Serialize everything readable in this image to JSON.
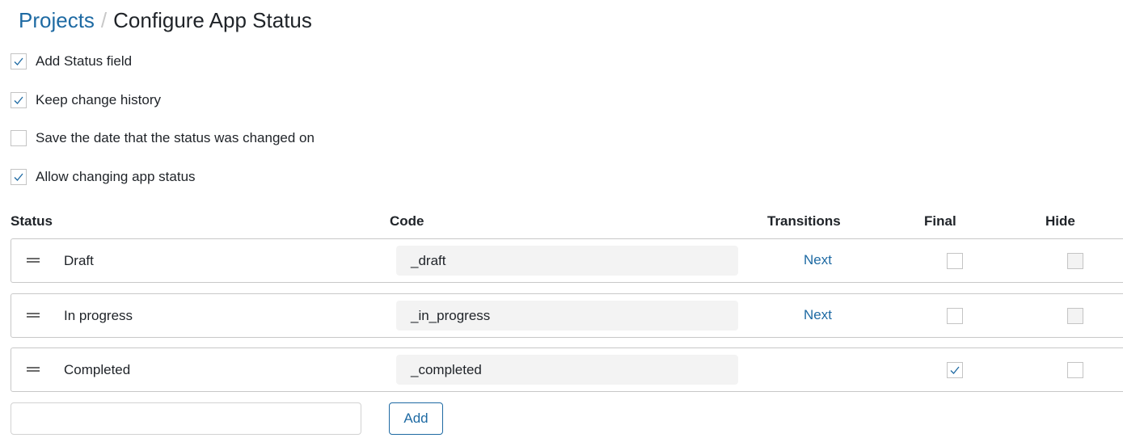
{
  "breadcrumb": {
    "parent": "Projects",
    "separator": "/",
    "title": "Configure App Status"
  },
  "options": [
    {
      "label": "Add Status field",
      "checked": true
    },
    {
      "label": "Keep change history",
      "checked": true
    },
    {
      "label": "Save the date that the status was changed on",
      "checked": false
    },
    {
      "label": "Allow changing app status",
      "checked": true
    }
  ],
  "table": {
    "headers": {
      "status": "Status",
      "code": "Code",
      "transitions": "Transitions",
      "final": "Final",
      "hide": "Hide"
    },
    "rows": [
      {
        "status": "Draft",
        "code": "_draft",
        "transition": "Next",
        "final": false,
        "hide": false,
        "hide_disabled": true
      },
      {
        "status": "In progress",
        "code": "_in_progress",
        "transition": "Next",
        "final": false,
        "hide": false,
        "hide_disabled": true
      },
      {
        "status": "Completed",
        "code": "_completed",
        "transition": "",
        "final": true,
        "hide": false,
        "hide_disabled": false
      }
    ]
  },
  "new_status": {
    "value": "",
    "placeholder": "",
    "add_label": "Add"
  },
  "colors": {
    "accent": "#1e6aa3",
    "text": "#1f2328",
    "border": "#c8c8c8",
    "field_bg": "#f3f3f3"
  }
}
